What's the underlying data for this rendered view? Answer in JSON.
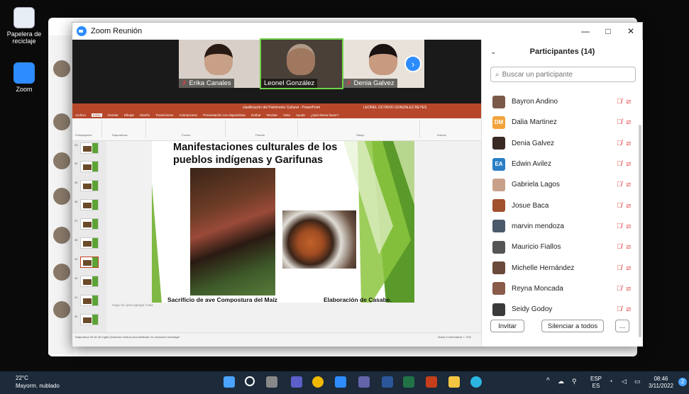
{
  "desktop": {
    "icons": [
      {
        "label": "Papelera de reciclaje",
        "icon": "recycle-bin-icon"
      },
      {
        "label": "Zoom",
        "icon": "zoom-app-icon"
      }
    ]
  },
  "window": {
    "title": "Zoom Reunión",
    "controls": [
      "—",
      "□",
      "✕"
    ]
  },
  "gallery": [
    {
      "name": "Erika Canales",
      "muted": true
    },
    {
      "name": "Leonel González",
      "muted": false,
      "active": true
    },
    {
      "name": "Denia Galvez",
      "muted": true
    }
  ],
  "powerpoint": {
    "window_title": "clasificación del Patrimonio Cultural - PowerPoint",
    "user": "LEONEL OCTAVIO GONZALEZ REYES",
    "menu": [
      "Archivo",
      "Inicio",
      "Insertar",
      "Dibujar",
      "Diseño",
      "Transiciones",
      "Animaciones",
      "Presentación con diapositivas",
      "Grabar",
      "Revisar",
      "Vista",
      "Ayuda",
      "¿Qué desea hacer?"
    ],
    "ribbon_groups": [
      "Portapapeles",
      "Diapositivas",
      "Fuente",
      "Párrafo",
      "Dibujo",
      "Edición"
    ],
    "slide_numbers": [
      "33",
      "34",
      "35",
      "36",
      "37",
      "38",
      "39",
      "40",
      "41",
      "42"
    ],
    "selected_slide": "39",
    "slide": {
      "title": "Manifestaciones culturales de los pueblos indígenas y Garifunas",
      "caption_left": "Sacrificio de ave Compostura del Maíz",
      "caption_right": "Elaboración de Casabe."
    },
    "notes_placeholder": "Haga clic para agregar notas",
    "status": "Diapositiva 39 de 45    Inglés (Estados Unidos)    Accesibilidad: es necesario investigar",
    "status_right": "Notas   Comentarios   + 74%"
  },
  "participants": {
    "header": "Participantes (14)",
    "search_placeholder": "Buscar un participante",
    "list": [
      {
        "name": "Bayron Andino",
        "avatar": "photo",
        "color": "#7a5a4a"
      },
      {
        "name": "Dalia Martinez",
        "avatar": "initials",
        "initials": "DM",
        "color": "#f2a33a"
      },
      {
        "name": "Denia Galvez",
        "avatar": "photo",
        "color": "#3a2a24"
      },
      {
        "name": "Edwin Avilez",
        "avatar": "initials",
        "initials": "EA",
        "color": "#2a7fc4"
      },
      {
        "name": "Gabriela Lagos",
        "avatar": "photo",
        "color": "#c9a08a"
      },
      {
        "name": "Josue Baca",
        "avatar": "photo",
        "color": "#a0522d"
      },
      {
        "name": "marvin mendoza",
        "avatar": "photo",
        "color": "#4a5a6a"
      },
      {
        "name": "Mauricio Fiallos",
        "avatar": "photo",
        "color": "#555555"
      },
      {
        "name": "Michelle Hernández",
        "avatar": "photo",
        "color": "#6a4a3a"
      },
      {
        "name": "Reyna Moncada",
        "avatar": "photo",
        "color": "#8a5a4a"
      },
      {
        "name": "Seidy Godoy",
        "avatar": "photo",
        "color": "#3a3a3a"
      }
    ],
    "invite_label": "Invitar",
    "mute_all_label": "Silenciar a todos",
    "more_label": "..."
  },
  "taskbar": {
    "temp": "22°C",
    "weather": "Mayorm. nublado",
    "lang_top": "ESP",
    "lang_bottom": "ES",
    "time": "08:46",
    "date": "3/11/2022",
    "notif_count": "2"
  }
}
